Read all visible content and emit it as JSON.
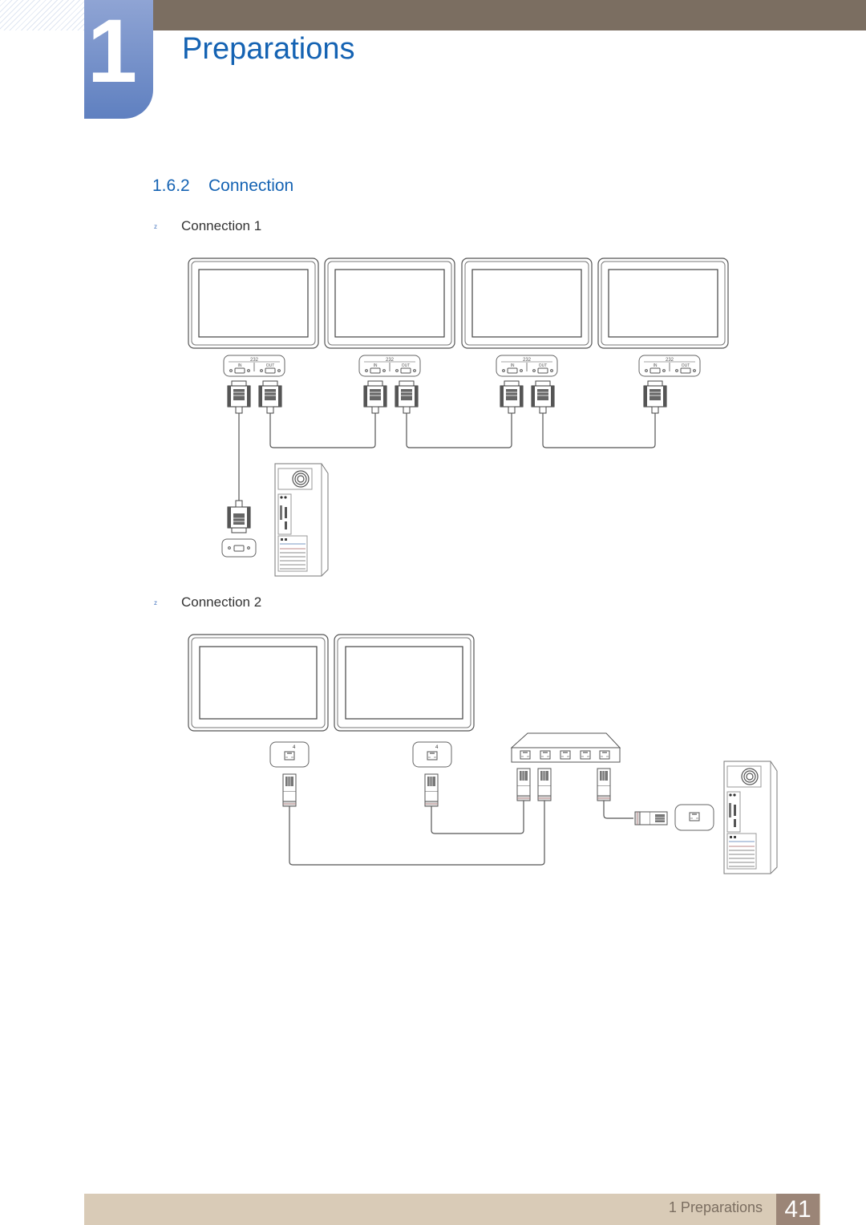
{
  "header": {
    "chapter_number": "1",
    "chapter_title": "Preparations"
  },
  "section": {
    "number": "1.6.2",
    "title": "Connection"
  },
  "connections": [
    {
      "bullet": "z",
      "label": "Connection 1",
      "diagram": {
        "monitors": 4,
        "port_panel_label": "RS232C",
        "port_in_label": "IN",
        "port_out_label": "OUT",
        "cable_type": "RS232C daisy chain",
        "endpoint": "PC serial port"
      }
    },
    {
      "bullet": "z",
      "label": "Connection 2",
      "diagram": {
        "monitors": 2,
        "port_panel_label": "RJ45",
        "cable_type": "LAN via hub",
        "hub_ports": 5,
        "endpoint": "PC LAN port"
      }
    }
  ],
  "footer": {
    "section_label": "1 Preparations",
    "page_number": "41"
  },
  "colors": {
    "accent_blue": "#1563b3",
    "topbar_brown": "#7b6e61",
    "footer_beige": "#d9cbb7",
    "page_box": "#9b8577"
  }
}
